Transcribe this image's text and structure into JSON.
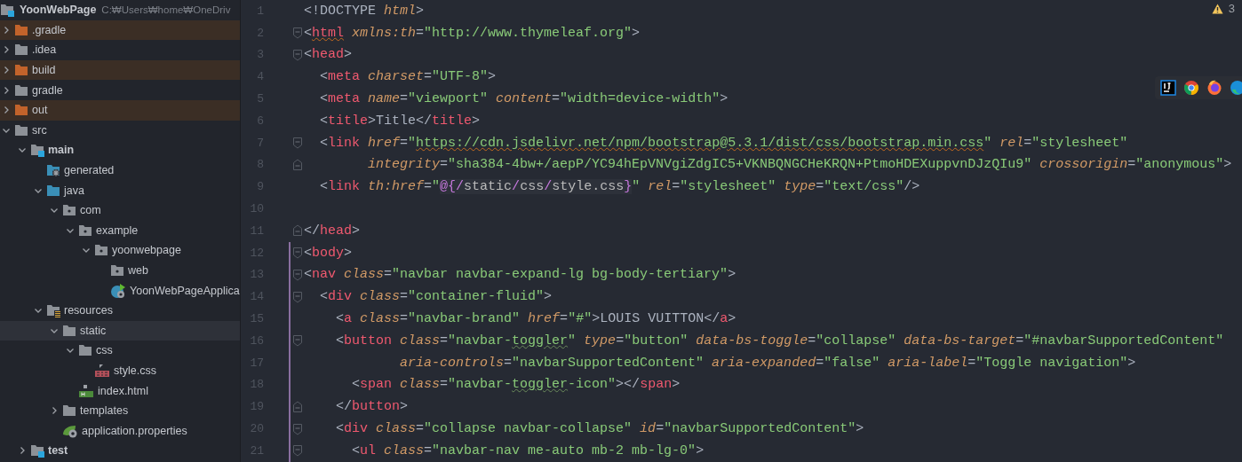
{
  "project": {
    "name": "YoonWebPage",
    "path": "C:₩Users₩home₩OneDriv"
  },
  "tree": [
    {
      "label": ".gradle",
      "kind": "excluded-folder",
      "expanded": false,
      "selected": false
    },
    {
      "label": ".idea",
      "kind": "folder",
      "expanded": false,
      "selected": false
    },
    {
      "label": "build",
      "kind": "excluded-folder",
      "expanded": false,
      "selected": false
    },
    {
      "label": "gradle",
      "kind": "folder",
      "expanded": false,
      "selected": false
    },
    {
      "label": "out",
      "kind": "excluded-folder",
      "expanded": false,
      "selected": false
    },
    {
      "label": "src",
      "kind": "folder",
      "expanded": true,
      "selected": false,
      "children": [
        {
          "label": "main",
          "kind": "module-folder",
          "expanded": true,
          "selected": false,
          "children": [
            {
              "label": "generated",
              "kind": "generated-folder",
              "selected": false
            },
            {
              "label": "java",
              "kind": "source-folder",
              "expanded": true,
              "selected": false,
              "children": [
                {
                  "label": "com",
                  "kind": "package",
                  "expanded": true,
                  "selected": false,
                  "children": [
                    {
                      "label": "example",
                      "kind": "package",
                      "expanded": true,
                      "selected": false,
                      "children": [
                        {
                          "label": "yoonwebpage",
                          "kind": "package",
                          "expanded": true,
                          "selected": false,
                          "children": [
                            {
                              "label": "web",
                              "kind": "package",
                              "selected": false
                            },
                            {
                              "label": "YoonWebPageApplica",
                              "kind": "spring-class",
                              "selected": false
                            }
                          ]
                        }
                      ]
                    }
                  ]
                }
              ]
            },
            {
              "label": "resources",
              "kind": "resources-folder",
              "expanded": true,
              "selected": false,
              "children": [
                {
                  "label": "static",
                  "kind": "folder",
                  "expanded": true,
                  "selected": true,
                  "children": [
                    {
                      "label": "css",
                      "kind": "folder",
                      "expanded": true,
                      "selected": false,
                      "children": [
                        {
                          "label": "style.css",
                          "kind": "css-file",
                          "selected": false
                        }
                      ]
                    },
                    {
                      "label": "index.html",
                      "kind": "html-file",
                      "selected": false
                    }
                  ]
                },
                {
                  "label": "templates",
                  "kind": "folder",
                  "expanded": false,
                  "selected": false
                },
                {
                  "label": "application.properties",
                  "kind": "properties-file",
                  "selected": false
                }
              ]
            }
          ]
        },
        {
          "label": "test",
          "kind": "module-folder",
          "expanded": false,
          "selected": false
        }
      ]
    }
  ],
  "editor": {
    "warnings": "3",
    "lines": [
      {
        "number": "1",
        "changed": false,
        "tokens": [
          {
            "kind": "punct",
            "text": "<!DOCTYPE"
          },
          {
            "kind": "attr",
            "text": " html"
          },
          {
            "kind": "punct",
            "text": ">"
          }
        ]
      },
      {
        "number": "2",
        "changed": false,
        "fold_open": true,
        "tokens": [
          {
            "kind": "punct",
            "text": "<"
          },
          {
            "kind": "tag",
            "text": "html",
            "warning": true
          },
          {
            "kind": "attr",
            "text": " xmlns:th"
          },
          {
            "kind": "punct",
            "text": "="
          },
          {
            "kind": "str",
            "text": "\"http://www.thymeleaf.org\""
          },
          {
            "kind": "punct",
            "text": ">"
          }
        ]
      },
      {
        "number": "3",
        "changed": false,
        "fold_open": true,
        "tokens": [
          {
            "kind": "punct",
            "text": "<"
          },
          {
            "kind": "tag",
            "text": "head"
          },
          {
            "kind": "punct",
            "text": ">"
          }
        ]
      },
      {
        "number": "4",
        "changed": false,
        "tokens": [
          {
            "kind": "punct",
            "text": "  <"
          },
          {
            "kind": "tag",
            "text": "meta"
          },
          {
            "kind": "attr",
            "text": " charset"
          },
          {
            "kind": "punct",
            "text": "="
          },
          {
            "kind": "str",
            "text": "\"UTF-8\""
          },
          {
            "kind": "punct",
            "text": ">"
          }
        ]
      },
      {
        "number": "5",
        "changed": false,
        "tokens": [
          {
            "kind": "punct",
            "text": "  <"
          },
          {
            "kind": "tag",
            "text": "meta"
          },
          {
            "kind": "attr",
            "text": " name"
          },
          {
            "kind": "punct",
            "text": "="
          },
          {
            "kind": "str",
            "text": "\"viewport\""
          },
          {
            "kind": "attr",
            "text": " content"
          },
          {
            "kind": "punct",
            "text": "="
          },
          {
            "kind": "str",
            "text": "\"width=device-width\""
          },
          {
            "kind": "punct",
            "text": ">"
          }
        ]
      },
      {
        "number": "6",
        "changed": false,
        "tokens": [
          {
            "kind": "punct",
            "text": "  <"
          },
          {
            "kind": "tag",
            "text": "title"
          },
          {
            "kind": "punct",
            "text": ">Title</"
          },
          {
            "kind": "tag",
            "text": "title"
          },
          {
            "kind": "punct",
            "text": ">"
          }
        ]
      },
      {
        "number": "7",
        "changed": false,
        "fold_open": true,
        "tokens": [
          {
            "kind": "punct",
            "text": "  <"
          },
          {
            "kind": "tag",
            "text": "link"
          },
          {
            "kind": "attr",
            "text": " href"
          },
          {
            "kind": "punct",
            "text": "="
          },
          {
            "kind": "str",
            "text": "\""
          },
          {
            "kind": "str",
            "text": "https://cdn.jsdelivr.net/npm/bootstrap@5.3.1/dist/css/bootstrap.min.css",
            "warning": true
          },
          {
            "kind": "str",
            "text": "\""
          },
          {
            "kind": "attr",
            "text": " rel"
          },
          {
            "kind": "punct",
            "text": "="
          },
          {
            "kind": "str",
            "text": "\"stylesheet\""
          }
        ]
      },
      {
        "number": "8",
        "changed": false,
        "fold_open": false,
        "tokens": [
          {
            "kind": "attr",
            "text": "        integrity"
          },
          {
            "kind": "punct",
            "text": "="
          },
          {
            "kind": "str",
            "text": "\"sha384-4bw+/aepP/YC94hEpVNVgiZdgIC5+VKNBQNGCHeKRQN+PtmoHDEXuppvnDJzQIu9\""
          },
          {
            "kind": "attr",
            "text": " crossorigin"
          },
          {
            "kind": "punct",
            "text": "="
          },
          {
            "kind": "str",
            "text": "\"anonymous\""
          },
          {
            "kind": "punct",
            "text": ">"
          }
        ]
      },
      {
        "number": "9",
        "changed": false,
        "tokens": [
          {
            "kind": "punct",
            "text": "  <"
          },
          {
            "kind": "tag",
            "text": "link"
          },
          {
            "kind": "attr",
            "text": " th:href"
          },
          {
            "kind": "punct",
            "text": "="
          },
          {
            "kind": "str",
            "text": "\""
          },
          {
            "kind": "expr",
            "text": "@{/"
          },
          {
            "kind": "plain",
            "text": "static"
          },
          {
            "kind": "expr",
            "text": "/"
          },
          {
            "kind": "plain",
            "text": "css"
          },
          {
            "kind": "expr",
            "text": "/"
          },
          {
            "kind": "plain",
            "text": "style.css"
          },
          {
            "kind": "expr",
            "text": "}"
          },
          {
            "kind": "str",
            "text": "\""
          },
          {
            "kind": "attr",
            "text": " rel"
          },
          {
            "kind": "punct",
            "text": "="
          },
          {
            "kind": "str",
            "text": "\"stylesheet\""
          },
          {
            "kind": "attr",
            "text": " type"
          },
          {
            "kind": "punct",
            "text": "="
          },
          {
            "kind": "str",
            "text": "\"text/css\""
          },
          {
            "kind": "punct",
            "text": "/>"
          }
        ]
      },
      {
        "number": "10",
        "changed": false
      },
      {
        "number": "11",
        "changed": false,
        "fold_open": false,
        "tokens": [
          {
            "kind": "punct",
            "text": "</"
          },
          {
            "kind": "tag",
            "text": "head"
          },
          {
            "kind": "punct",
            "text": ">"
          }
        ]
      },
      {
        "number": "12",
        "changed": true,
        "fold_open": true,
        "tokens": [
          {
            "kind": "punct",
            "text": "<"
          },
          {
            "kind": "tag",
            "text": "body"
          },
          {
            "kind": "punct",
            "text": ">"
          }
        ]
      },
      {
        "number": "13",
        "changed": true,
        "fold_open": true,
        "tokens": [
          {
            "kind": "punct",
            "text": "<"
          },
          {
            "kind": "tag",
            "text": "nav"
          },
          {
            "kind": "attr",
            "text": " class"
          },
          {
            "kind": "punct",
            "text": "="
          },
          {
            "kind": "str",
            "text": "\"navbar navbar-expand-lg bg-body-tertiary\""
          },
          {
            "kind": "punct",
            "text": ">"
          }
        ]
      },
      {
        "number": "14",
        "changed": true,
        "fold_open": true,
        "tokens": [
          {
            "kind": "punct",
            "text": "  <"
          },
          {
            "kind": "tag",
            "text": "div"
          },
          {
            "kind": "attr",
            "text": " class"
          },
          {
            "kind": "punct",
            "text": "="
          },
          {
            "kind": "str",
            "text": "\"container-fluid\""
          },
          {
            "kind": "punct",
            "text": ">"
          }
        ]
      },
      {
        "number": "15",
        "changed": true,
        "tokens": [
          {
            "kind": "punct",
            "text": "    <"
          },
          {
            "kind": "tag",
            "text": "a"
          },
          {
            "kind": "attr",
            "text": " class"
          },
          {
            "kind": "punct",
            "text": "="
          },
          {
            "kind": "str",
            "text": "\"navbar-brand\""
          },
          {
            "kind": "attr",
            "text": " href"
          },
          {
            "kind": "punct",
            "text": "="
          },
          {
            "kind": "str",
            "text": "\"#\""
          },
          {
            "kind": "punct",
            "text": ">LOUIS VUITTON</"
          },
          {
            "kind": "tag",
            "text": "a"
          },
          {
            "kind": "punct",
            "text": ">"
          }
        ]
      },
      {
        "number": "16",
        "changed": true,
        "fold_open": true,
        "tokens": [
          {
            "kind": "punct",
            "text": "    <"
          },
          {
            "kind": "tag",
            "text": "button"
          },
          {
            "kind": "attr",
            "text": " class"
          },
          {
            "kind": "punct",
            "text": "="
          },
          {
            "kind": "str",
            "text": "\"navbar-"
          },
          {
            "kind": "str",
            "text": "toggler",
            "typo": true
          },
          {
            "kind": "str",
            "text": "\""
          },
          {
            "kind": "attr",
            "text": " type"
          },
          {
            "kind": "punct",
            "text": "="
          },
          {
            "kind": "str",
            "text": "\"button\""
          },
          {
            "kind": "attr",
            "text": " data-bs-toggle"
          },
          {
            "kind": "punct",
            "text": "="
          },
          {
            "kind": "str",
            "text": "\"collapse\""
          },
          {
            "kind": "attr",
            "text": " data-bs-target"
          },
          {
            "kind": "punct",
            "text": "="
          },
          {
            "kind": "str",
            "text": "\"#navbarSupportedContent\""
          }
        ]
      },
      {
        "number": "17",
        "changed": true,
        "tokens": [
          {
            "kind": "attr",
            "text": "            aria-controls"
          },
          {
            "kind": "punct",
            "text": "="
          },
          {
            "kind": "str",
            "text": "\"navbarSupportedContent\""
          },
          {
            "kind": "attr",
            "text": " aria-expanded"
          },
          {
            "kind": "punct",
            "text": "="
          },
          {
            "kind": "str",
            "text": "\"false\""
          },
          {
            "kind": "attr",
            "text": " aria-label"
          },
          {
            "kind": "punct",
            "text": "="
          },
          {
            "kind": "str",
            "text": "\"Toggle navigation\""
          },
          {
            "kind": "punct",
            "text": ">"
          }
        ]
      },
      {
        "number": "18",
        "changed": true,
        "tokens": [
          {
            "kind": "punct",
            "text": "      <"
          },
          {
            "kind": "tag",
            "text": "span"
          },
          {
            "kind": "attr",
            "text": " class"
          },
          {
            "kind": "punct",
            "text": "="
          },
          {
            "kind": "str",
            "text": "\"navbar-"
          },
          {
            "kind": "str",
            "text": "toggler",
            "typo": true
          },
          {
            "kind": "str",
            "text": "-icon\""
          },
          {
            "kind": "punct",
            "text": "></"
          },
          {
            "kind": "tag",
            "text": "span"
          },
          {
            "kind": "punct",
            "text": ">"
          }
        ]
      },
      {
        "number": "19",
        "changed": true,
        "fold_open": false,
        "tokens": [
          {
            "kind": "punct",
            "text": "    </"
          },
          {
            "kind": "tag",
            "text": "button"
          },
          {
            "kind": "punct",
            "text": ">"
          }
        ]
      },
      {
        "number": "20",
        "changed": true,
        "fold_open": true,
        "tokens": [
          {
            "kind": "punct",
            "text": "    <"
          },
          {
            "kind": "tag",
            "text": "div"
          },
          {
            "kind": "attr",
            "text": " class"
          },
          {
            "kind": "punct",
            "text": "="
          },
          {
            "kind": "str",
            "text": "\"collapse navbar-collapse\""
          },
          {
            "kind": "attr",
            "text": " id"
          },
          {
            "kind": "punct",
            "text": "="
          },
          {
            "kind": "str",
            "text": "\"navbarSupportedContent\""
          },
          {
            "kind": "punct",
            "text": ">"
          }
        ]
      },
      {
        "number": "21",
        "changed": true,
        "fold_open": true,
        "tokens": [
          {
            "kind": "punct",
            "text": "      <"
          },
          {
            "kind": "tag",
            "text": "ul"
          },
          {
            "kind": "attr",
            "text": " class"
          },
          {
            "kind": "punct",
            "text": "="
          },
          {
            "kind": "str",
            "text": "\"navbar-nav me-auto mb-2 mb-lg-0\""
          },
          {
            "kind": "punct",
            "text": ">"
          }
        ]
      }
    ]
  },
  "browser_bar": [
    {
      "kind": "intellij"
    },
    {
      "kind": "chrome"
    },
    {
      "kind": "firefox"
    },
    {
      "kind": "edge"
    }
  ]
}
